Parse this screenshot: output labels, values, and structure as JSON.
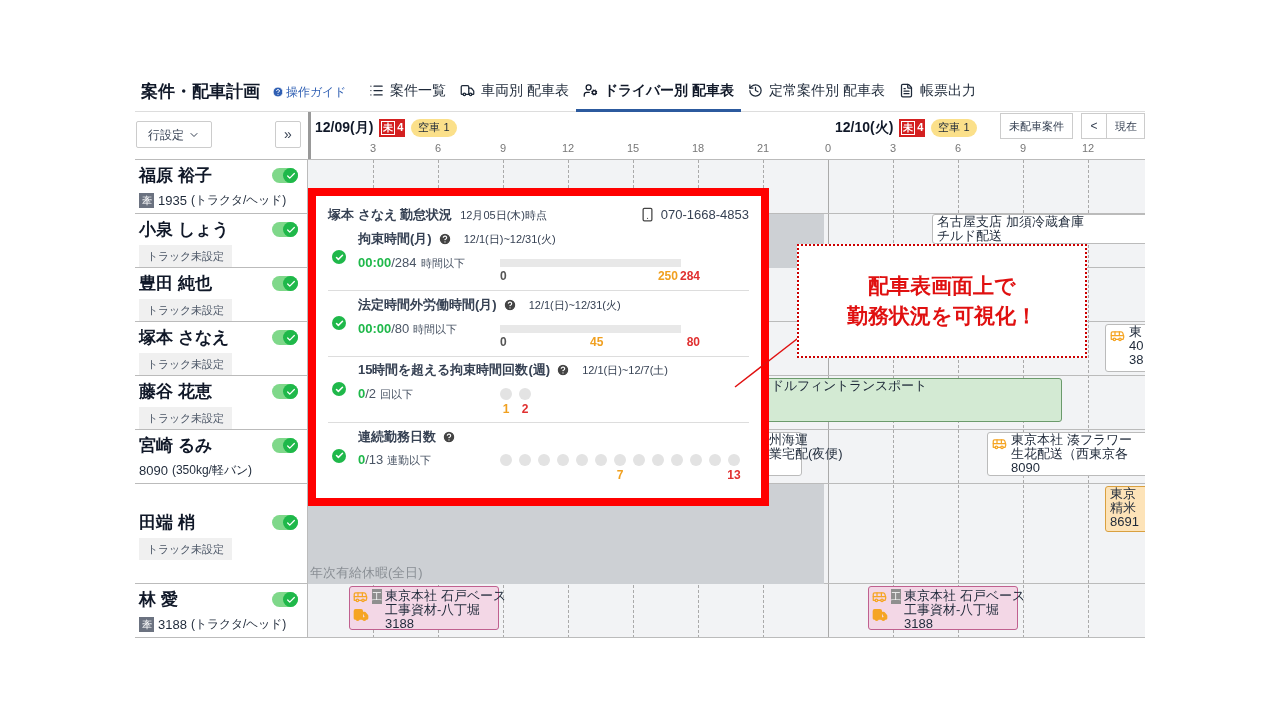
{
  "header": {
    "title": "案件・配車計画",
    "guide": "操作ガイド",
    "tabs": [
      {
        "label": "案件一覧",
        "selected": false
      },
      {
        "label": "車両別 配車表",
        "selected": false
      },
      {
        "label": "ドライバー別 配車表",
        "selected": true
      },
      {
        "label": "定常案件別 配車表",
        "selected": false
      },
      {
        "label": "帳票出力",
        "selected": false
      }
    ]
  },
  "toolbar": {
    "row_settings": "行設定",
    "expand": "»",
    "unassigned_button": "未配車案件",
    "prev": "<",
    "today": "現在"
  },
  "days": [
    {
      "date": "12/09(月)",
      "unassigned_mark": "未",
      "unassigned_count": "4",
      "empty": "空車 1",
      "ticks": [
        "3",
        "6",
        "9",
        "12",
        "15",
        "18",
        "21"
      ]
    },
    {
      "date": "12/10(火)",
      "unassigned_mark": "未",
      "unassigned_count": "4",
      "empty": "空車 1",
      "ticks": [
        "0",
        "3",
        "6",
        "9",
        "12"
      ]
    }
  ],
  "drivers": [
    {
      "name": "福原 裕子",
      "on": true,
      "vehicle": {
        "kind": "tractor",
        "badge": "牽",
        "number": "1935",
        "type": "(トラクタ/ヘッド)"
      }
    },
    {
      "name": "小泉 しょう",
      "on": true,
      "vehicle": {
        "kind": "unset",
        "text": "トラック未設定"
      },
      "events": [
        {
          "kind": "off"
        },
        {
          "kind": "standard",
          "bus": false,
          "lines": [
            "名古屋支店 加須冷蔵倉庫",
            "チルド配送"
          ]
        }
      ]
    },
    {
      "name": "豊田 純也",
      "on": true,
      "vehicle": {
        "kind": "unset",
        "text": "トラック未設定"
      }
    },
    {
      "name": "塚本 さなえ",
      "on": true,
      "vehicle": {
        "kind": "unset",
        "text": "トラック未設定"
      },
      "events": [
        {
          "kind": "standard",
          "bus": true,
          "lines": [
            "東",
            "40",
            "38"
          ]
        }
      ]
    },
    {
      "name": "藤谷 花恵",
      "on": true,
      "vehicle": {
        "kind": "unset",
        "text": "トラック未設定"
      },
      "events": [
        {
          "kind": "group",
          "lines": [
            "ドルフィントランスポート"
          ]
        }
      ]
    },
    {
      "name": "宮崎 るみ",
      "on": true,
      "vehicle": {
        "kind": "plain",
        "number": "8090",
        "type": "(350kg/軽バン)"
      },
      "events": [
        {
          "kind": "standard",
          "bus": false,
          "lines": [
            "州海運",
            "業宅配(夜便)"
          ]
        },
        {
          "kind": "standard",
          "bus": true,
          "lines": [
            "東京本社 湊フラワー",
            "生花配送（西東京各",
            "8090"
          ]
        }
      ]
    },
    {
      "name": "田端 梢",
      "on": true,
      "vehicle": {
        "kind": "unset",
        "text": "トラック未設定"
      },
      "events": [
        {
          "kind": "leave",
          "label": "年次有給休暇(全日)"
        },
        {
          "kind": "pending",
          "lines": [
            "東京",
            "精米",
            "8691"
          ]
        }
      ]
    },
    {
      "name": "林 愛",
      "on": true,
      "vehicle": {
        "kind": "tractor",
        "badge": "牽",
        "number": "3188",
        "type": "(トラクタ/ヘッド)"
      },
      "events": [
        {
          "kind": "badge",
          "badge": "工",
          "lines": [
            "東京本社 石戸ベース",
            "工事資材-八丁堀",
            "3188"
          ]
        },
        {
          "kind": "badge",
          "badge": "工",
          "lines": [
            "東京本社 石戸ベース",
            "工事資材-八丁堀",
            "3188"
          ]
        }
      ]
    }
  ],
  "attendance": {
    "title": "塚本 さなえ 勤怠状況",
    "as_of": "12月05日(木)時点",
    "phone": "070-1668-4853",
    "metrics": [
      {
        "title": "拘束時間(月)",
        "period": "12/1(日)~12/31(火)",
        "ok": true,
        "value": "00:00",
        "limit": "/284",
        "unit": "時間以下",
        "scale": {
          "kind": "bar",
          "level": 0,
          "labels": [
            {
              "kind": "start",
              "text": "0",
              "color": "#555555"
            },
            {
              "kind": "end",
              "text": "250",
              "color": "#f0a020"
            },
            {
              "kind": "end",
              "text": "284",
              "color": "#e03030"
            }
          ]
        }
      },
      {
        "title": "法定時間外労働時間(月)",
        "period": "12/1(日)~12/31(火)",
        "ok": true,
        "value": "00:00",
        "limit": "/80",
        "unit": "時間以下",
        "scale": {
          "kind": "bar",
          "level": 0,
          "labels": [
            {
              "kind": "start",
              "text": "0",
              "color": "#555555"
            },
            {
              "kind": "middle",
              "text": "45",
              "color": "#f0a020"
            },
            {
              "kind": "end",
              "text": "80",
              "color": "#e03030"
            }
          ]
        }
      },
      {
        "title": "15時間を超える拘束時間回数(週)",
        "period": "12/1(日)~12/7(土)",
        "ok": true,
        "value": "0",
        "limit": "/2",
        "unit": "回以下",
        "scale": {
          "kind": "dots",
          "dots": [
            {
              "filled": false,
              "label": "1",
              "color": "#f0a020"
            },
            {
              "filled": false,
              "label": "2",
              "color": "#e03030"
            }
          ]
        }
      },
      {
        "title": "連続勤務日数",
        "ok": true,
        "value": "0",
        "limit": "/13",
        "unit": "連勤以下",
        "scale": {
          "kind": "dots",
          "dots": [
            {
              "filled": false
            },
            {
              "filled": false
            },
            {
              "filled": false
            },
            {
              "filled": false
            },
            {
              "filled": false
            },
            {
              "filled": false
            },
            {
              "filled": false,
              "label": "7",
              "color": "#f0a020"
            },
            {
              "filled": false
            },
            {
              "filled": false
            },
            {
              "filled": false
            },
            {
              "filled": false
            },
            {
              "filled": false
            },
            {
              "filled": false,
              "label": "13",
              "color": "#e03030"
            }
          ]
        }
      }
    ]
  },
  "callout": {
    "lines": [
      "配車表画面上で",
      "勤務状況を可視化！"
    ]
  }
}
